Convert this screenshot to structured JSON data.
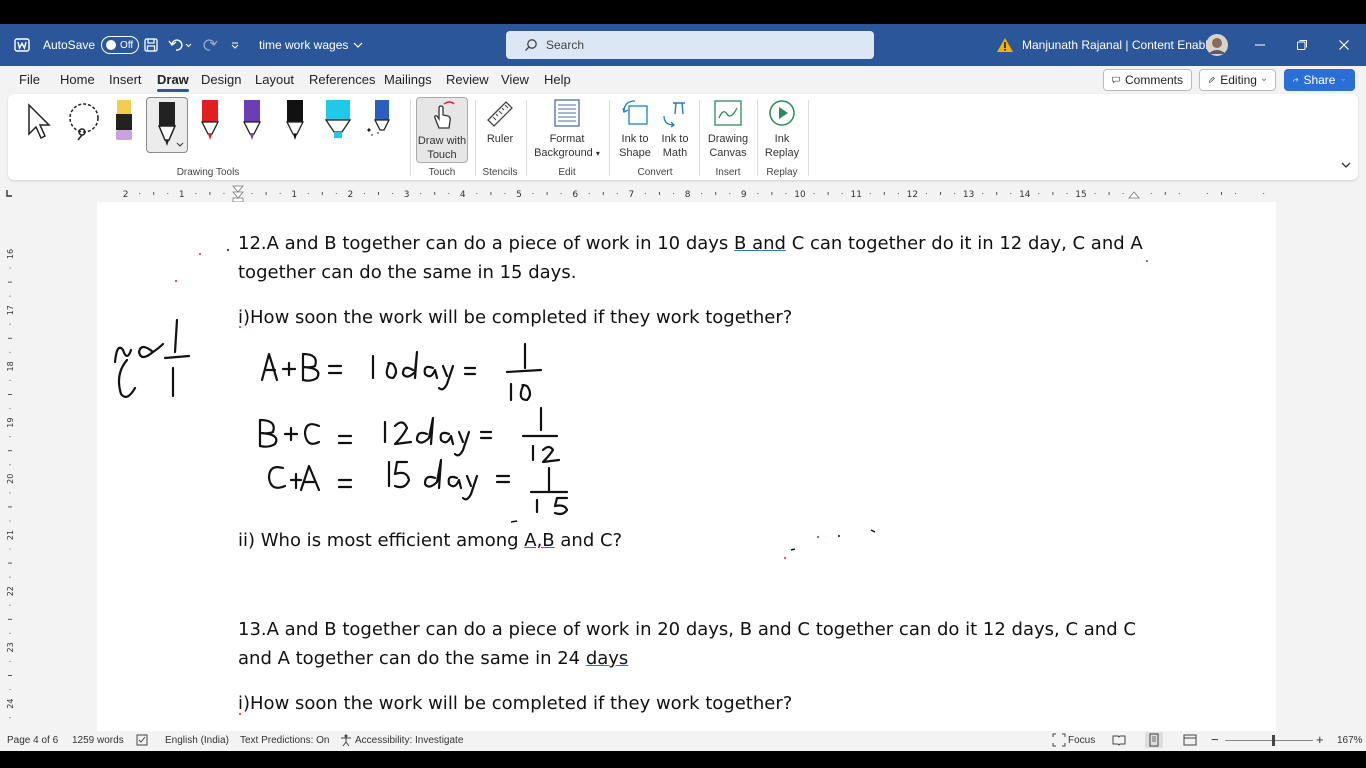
{
  "titlebar": {
    "autosave_label": "AutoSave",
    "autosave_state": "Off",
    "doc_title": "time work wages",
    "search_placeholder": "Search",
    "user": "Manjunath Rajanal | Content Enablers"
  },
  "menu": {
    "tabs": [
      "File",
      "Home",
      "Insert",
      "Draw",
      "Design",
      "Layout",
      "References",
      "Mailings",
      "Review",
      "View",
      "Help"
    ],
    "active_tab": "Draw",
    "comments_label": "Comments",
    "editing_label": "Editing",
    "share_label": "Share"
  },
  "ribbon": {
    "group_drawing_tools": "Drawing Tools",
    "draw_with_touch": "Draw with Touch",
    "group_touch": "Touch",
    "ruler": "Ruler",
    "group_stencils": "Stencils",
    "format_background": "Format Background",
    "group_edit": "Edit",
    "ink_to_shape": "Ink to Shape",
    "ink_to_math": "Ink to Math",
    "group_convert": "Convert",
    "drawing_canvas": "Drawing Canvas",
    "group_insert": "Insert",
    "ink_replay": "Ink Replay",
    "group_replay": "Replay",
    "pen_colors": [
      "#e8c34a",
      "#222222",
      "#e02020",
      "#6a3fb5",
      "#111111",
      "#22c8e8",
      "#2a5fc0"
    ]
  },
  "ruler": {
    "numbers": [
      "2",
      "1",
      "1",
      "2",
      "3",
      "4",
      "5",
      "6",
      "7",
      "8",
      "9",
      "10",
      "11",
      "12",
      "13",
      "14",
      "15"
    ],
    "vnumbers": [
      "16",
      "17",
      "18",
      "19",
      "20",
      "21",
      "22",
      "23",
      "24"
    ]
  },
  "document": {
    "q12_line1_a": "12.A and B together can do a piece of work in 10 days ",
    "q12_line1_b": "B  and",
    "q12_line1_c": " C can together do it in 12 day, C and A",
    "q12_line2": "together can do the same in 15 days.",
    "q12_i": "i)How soon the work will be completed if they work together?",
    "q12_ii_a": "ii) Who is most efficient among ",
    "q12_ii_b": "A,B",
    "q12_ii_c": " and C?",
    "q13_line1": "13.A and B together can do a piece of work in 20 days, B and C together can do it 12 days, C and C",
    "q13_line2_a": "and A together can do the same in 24 ",
    "q13_line2_b": "days",
    "q13_i": "i)How soon the work will be completed if they work together?"
  },
  "status": {
    "page": "Page 4 of 6",
    "words": "1259 words",
    "language": "English (India)",
    "predictions": "Text Predictions: On",
    "accessibility": "Accessibility: Investigate",
    "focus": "Focus",
    "zoom": "167%"
  }
}
